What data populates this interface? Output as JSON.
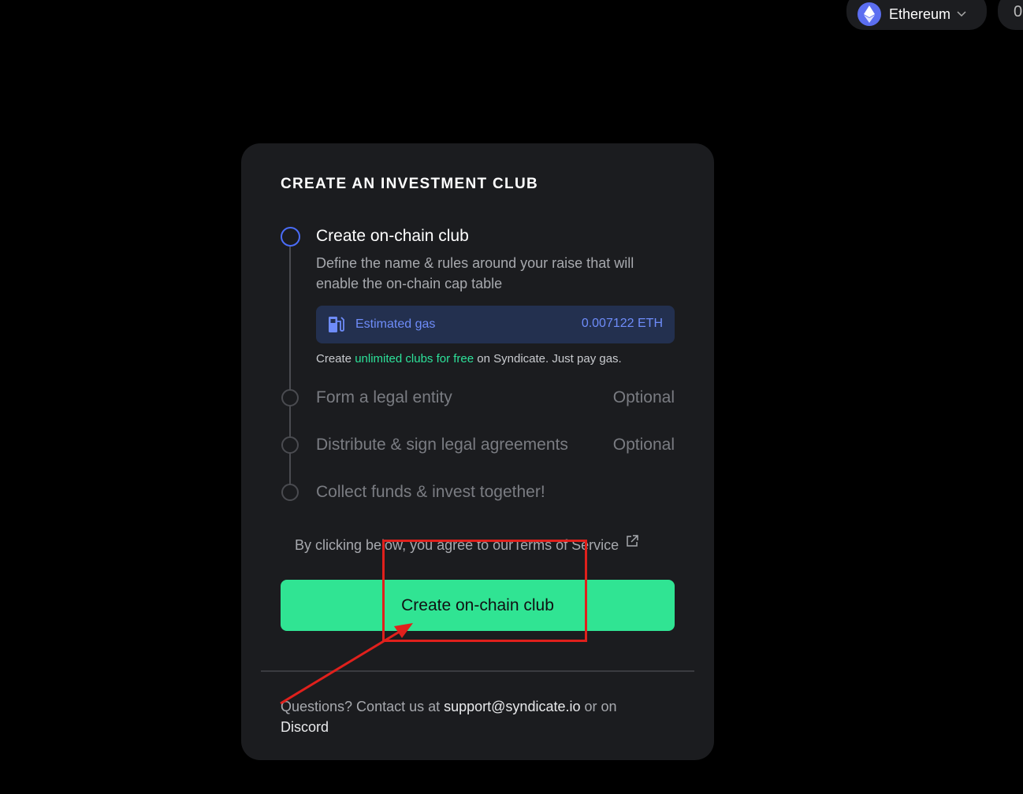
{
  "header": {
    "network": {
      "label": "Ethereum",
      "icon": "ethereum-icon",
      "color": "#5b6ef0"
    },
    "second_pill_text": "0"
  },
  "card": {
    "title": "CREATE AN INVESTMENT CLUB",
    "steps": [
      {
        "title": "Create on-chain club",
        "description": "Define the name & rules around your raise that will enable the on-chain cap table",
        "state": "active"
      },
      {
        "title": "Form a legal entity",
        "optional": "Optional",
        "state": "pending"
      },
      {
        "title": "Distribute & sign legal agreements",
        "optional": "Optional",
        "state": "pending"
      },
      {
        "title": "Collect funds & invest together!",
        "state": "pending"
      }
    ],
    "gas": {
      "label": "Estimated gas",
      "value": "0.007122 ETH",
      "icon": "gas-pump-icon"
    },
    "free_note": {
      "prefix": "Create ",
      "highlight": "unlimited clubs for free",
      "suffix": " on Syndicate. Just pay gas."
    },
    "agreement": {
      "prefix": "By clicking below, you agree to our ",
      "link": "Terms of Service",
      "icon": "external-link-icon"
    },
    "cta_label": "Create on-chain club",
    "footer": {
      "prefix": "Questions? Contact us at ",
      "email": "support@syndicate.io",
      "middle": " or on ",
      "discord": "Discord"
    }
  },
  "colors": {
    "accent_green": "#30e493",
    "active_blue": "#4a6cf7",
    "annotation_red": "#e0201c"
  }
}
